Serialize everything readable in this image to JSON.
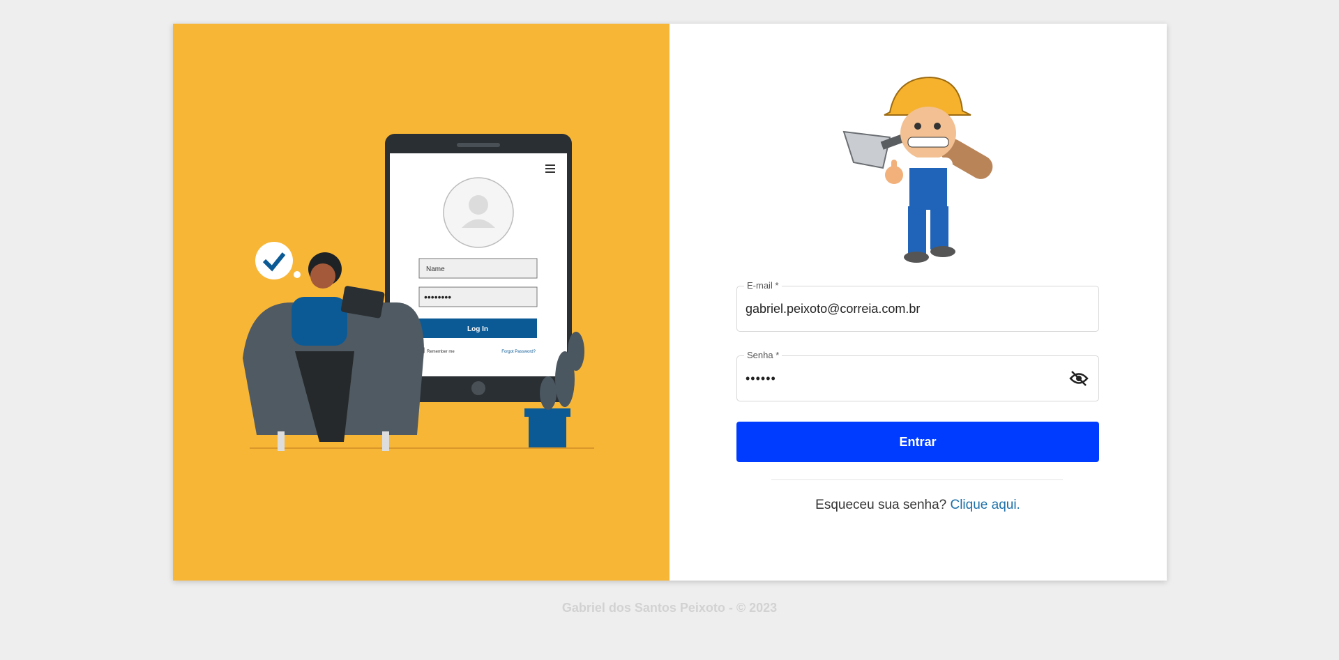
{
  "illustration": {
    "phone_name_placeholder": "Name",
    "phone_password_dots": "••••••••",
    "phone_login_button": "Log In",
    "phone_remember": "Remember me",
    "phone_forgot": "Forgot Password?"
  },
  "form": {
    "email_label": "E-mail *",
    "email_value": "gabriel.peixoto@correia.com.br",
    "senha_label": "Senha *",
    "senha_value": "••••••",
    "submit_label": "Entrar",
    "forgot_text": "Esqueceu sua senha? ",
    "forgot_link": "Clique aqui."
  },
  "footer": {
    "text": "Gabriel dos Santos Peixoto - © 2023"
  },
  "colors": {
    "left_panel": "#f8b636",
    "submit_button": "#003cff",
    "link": "#1b6fa8",
    "illustration_accent": "#0b5a96"
  },
  "icons": {
    "password_toggle": "eye-slash-icon"
  }
}
